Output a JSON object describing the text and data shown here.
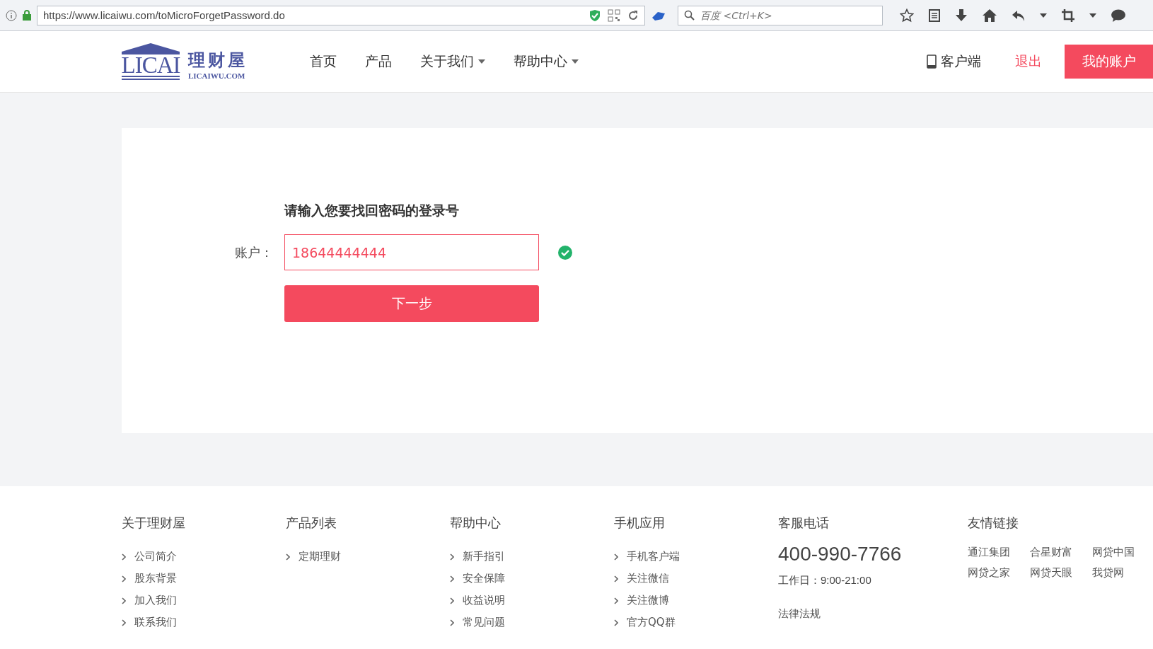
{
  "browser": {
    "url": "https://www.licaiwu.com/toMicroForgetPassword.do",
    "search_placeholder": "百度 <Ctrl+K>"
  },
  "header": {
    "logo": {
      "mark": "LICAI",
      "name": "理财屋",
      "domain": "LICAIWU.COM"
    },
    "nav": [
      {
        "label": "首页",
        "dropdown": false
      },
      {
        "label": "产品",
        "dropdown": false
      },
      {
        "label": "关于我们",
        "dropdown": true
      },
      {
        "label": "帮助中心",
        "dropdown": true
      }
    ],
    "client": "客户端",
    "logout": "退出",
    "account_button": "我的账户"
  },
  "form": {
    "title": "请输入您要找回密码的登录号",
    "label": "账户：",
    "value": "18644444444",
    "valid": true,
    "submit": "下一步"
  },
  "footer": {
    "columns": [
      {
        "heading": "关于理财屋",
        "links": [
          "公司简介",
          "股东背景",
          "加入我们",
          "联系我们"
        ]
      },
      {
        "heading": "产品列表",
        "links": [
          "定期理财"
        ]
      },
      {
        "heading": "帮助中心",
        "links": [
          "新手指引",
          "安全保障",
          "收益说明",
          "常见问题"
        ]
      },
      {
        "heading": "手机应用",
        "links": [
          "手机客户端",
          "关注微信",
          "关注微博",
          "官方QQ群"
        ]
      }
    ],
    "service": {
      "heading": "客服电话",
      "phone": "400-990-7766",
      "hours": "工作日：9:00-21:00",
      "legal": "法律法规"
    },
    "friends": {
      "heading": "友情链接",
      "links": [
        "通江集团",
        "合星财富",
        "网贷中国",
        "网贷之家",
        "网贷天眼",
        "我贷网"
      ]
    }
  }
}
